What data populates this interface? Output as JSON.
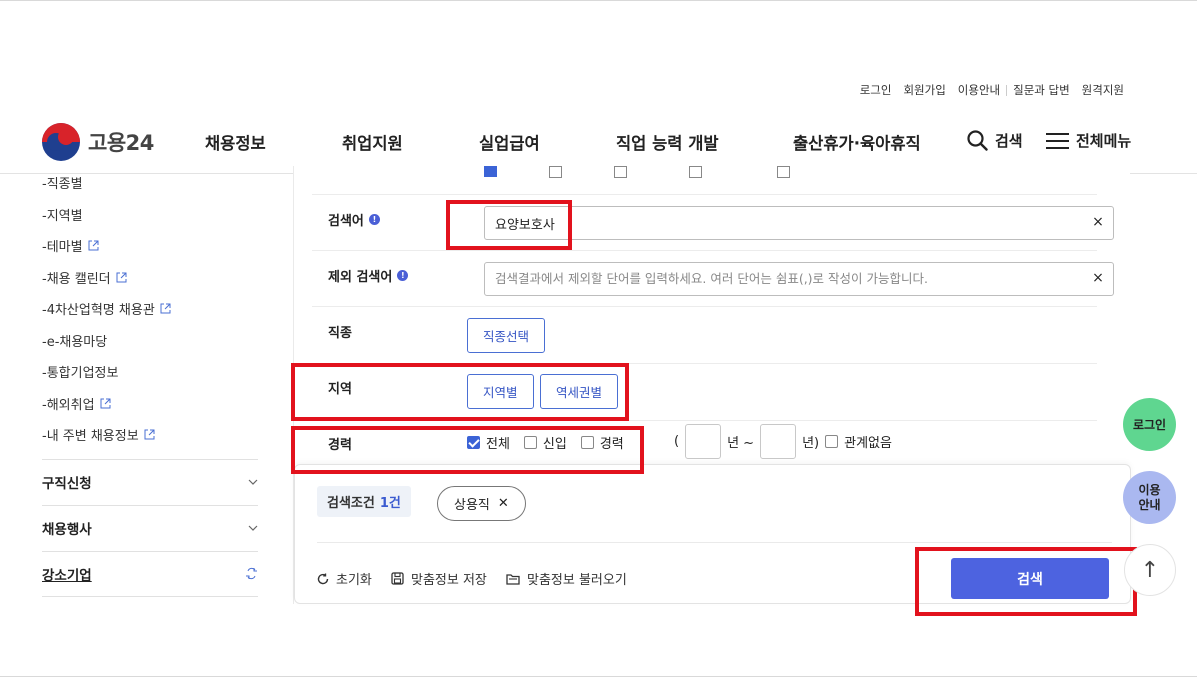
{
  "utility": [
    "로그인",
    "회원가입",
    "이용안내",
    "질문과 답변",
    "원격지원"
  ],
  "logo": {
    "text": "고용24"
  },
  "gnb": [
    "채용정보",
    "취업지원",
    "실업급여",
    "직업 능력 개발",
    "출산휴가·육아휴직"
  ],
  "header_tools": {
    "search": "검색",
    "menu": "전체메뉴"
  },
  "sidebar": {
    "sub_items": [
      {
        "label": "-직종별",
        "ext": false
      },
      {
        "label": "-지역별",
        "ext": false
      },
      {
        "label": "-테마별",
        "ext": true
      },
      {
        "label": "-채용 캘린더",
        "ext": true
      },
      {
        "label": "-4차산업혁명 채용관",
        "ext": true
      },
      {
        "label": "-e-채용마당",
        "ext": false
      },
      {
        "label": "-통합기업정보",
        "ext": false
      },
      {
        "label": "-해외취업",
        "ext": true
      },
      {
        "label": "-내 주변 채용정보",
        "ext": true
      }
    ],
    "groups": [
      "구직신청",
      "채용행사",
      "강소기업"
    ]
  },
  "form": {
    "keyword_label": "검색어",
    "keyword_value": "요양보호사",
    "exclude_label": "제외 검색어",
    "exclude_placeholder": "검색결과에서 제외할 단어를 입력하세요. 여러 단어는 쉼표(,)로 작성이 가능합니다.",
    "job_label": "직종",
    "job_button": "직종선택",
    "region_label": "지역",
    "region_buttons": [
      "지역별",
      "역세권별"
    ],
    "career_label": "경력",
    "career_options": [
      {
        "label": "전체",
        "checked": true
      },
      {
        "label": "신입",
        "checked": false
      },
      {
        "label": "경력",
        "checked": false
      }
    ],
    "career_paren_open": "(",
    "career_year_from": "년 ~",
    "career_year_to": "년)",
    "career_none": "관계없음"
  },
  "conditions": {
    "label": "검색조건",
    "count": "1건",
    "chips": [
      "상용직"
    ],
    "reset": "초기화",
    "save": "맞춤정보 저장",
    "load": "맞춤정보 불러오기",
    "search_button": "검색"
  },
  "floating": {
    "login": "로그인",
    "guide_line1": "이용",
    "guide_line2": "안내",
    "top": "↑"
  },
  "colors": {
    "primary": "#4d63e0",
    "highlight": "#e2121d",
    "login_bubble": "#5fd690",
    "guide_bubble": "#aab8f0"
  }
}
